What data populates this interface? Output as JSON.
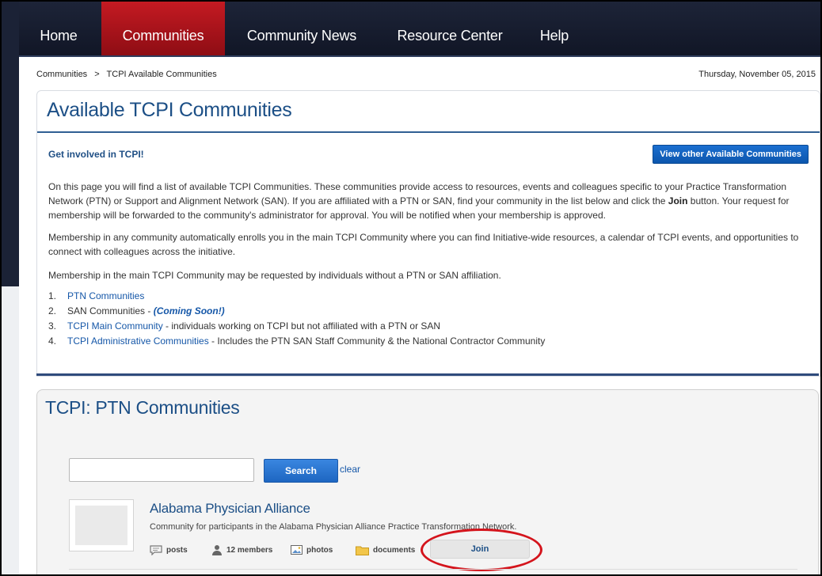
{
  "nav": {
    "items": [
      {
        "label": "Home"
      },
      {
        "label": "Communities",
        "active": true
      },
      {
        "label": "Community News"
      },
      {
        "label": "Resource Center"
      },
      {
        "label": "Help"
      }
    ]
  },
  "breadcrumb": {
    "items": [
      "Communities",
      "TCPI Available Communities"
    ],
    "separator": ">"
  },
  "date": "Thursday, November 05, 2015",
  "main": {
    "title": "Available TCPI Communities",
    "involved_heading": "Get involved in TCPI!",
    "other_button": "View other Available Communities",
    "para1_before": "On this page you will find a list of available TCPI Communities. These communities provide access to resources, events and colleagues specific to your Practice Transformation Network (PTN) or Support and Alignment Network (SAN). If you are affiliated with a PTN or SAN, find your community in the list below and click the ",
    "para1_bold": "Join",
    "para1_after": " button. Your request for membership will be forwarded to the community's administrator for approval. You will be notified when your membership is approved.",
    "para2": "Membership in any community automatically enrolls you in the main TCPI Community where you can find Initiative-wide resources, a calendar of TCPI events, and opportunities to connect with colleagues across the initiative.",
    "para3": "Membership in the main TCPI Community may be requested by individuals without a PTN or SAN affiliation.",
    "list": [
      {
        "num": "1.",
        "link": "PTN Communities",
        "text": ""
      },
      {
        "num": "2.",
        "text": "SAN Communities - ",
        "emph": "(Coming Soon!)"
      },
      {
        "num": "3.",
        "link": "TCPI Main Community",
        "text": " - individuals working on TCPI but not affiliated with a PTN or SAN"
      },
      {
        "num": "4.",
        "link": "TCPI Administrative Communities",
        "text": " - Includes the PTN SAN Staff Community & the National Contractor Community"
      }
    ]
  },
  "ptn": {
    "title": "TCPI: PTN Communities",
    "search": {
      "value": "",
      "placeholder": "",
      "button": "Search",
      "clear": "clear"
    },
    "community": {
      "name": "Alabama Physician Alliance",
      "description": "Community for participants in the Alabama Physician Alliance Practice Transformation Network.",
      "stats": {
        "posts": "posts",
        "members": "12 members",
        "photos": "photos",
        "documents": "documents"
      },
      "join": "Join"
    }
  },
  "colors": {
    "nav_bg": "#161c2e",
    "nav_active": "#b0141b",
    "title_blue": "#1c4f86",
    "link_blue": "#1557a8",
    "button_blue": "#1467c6",
    "highlight_red": "#d4141c"
  }
}
